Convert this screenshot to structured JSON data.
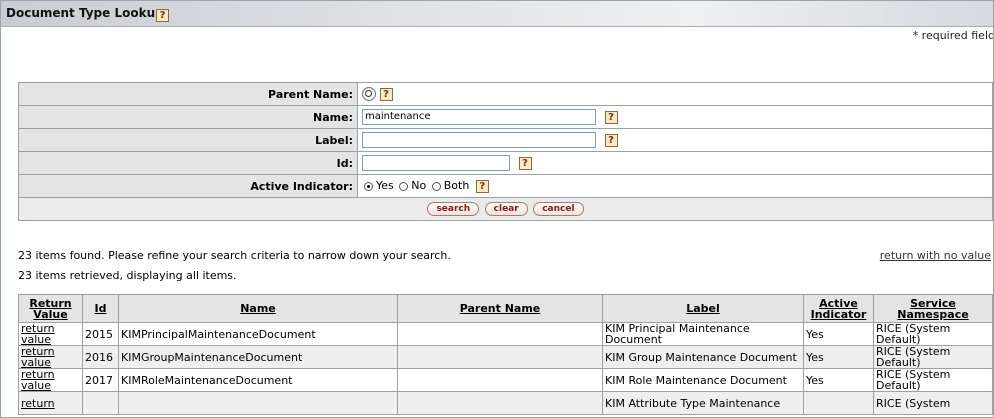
{
  "window": {
    "title": "Document Type Lookup"
  },
  "required_note": "* required field",
  "criteria": {
    "parent_name_label": "Parent Name:",
    "name_label": "Name:",
    "name_value": "maintenance",
    "label_label": "Label:",
    "label_value": "",
    "id_label": "Id:",
    "id_value": "",
    "active_label": "Active Indicator:",
    "active_options": [
      "Yes",
      "No",
      "Both"
    ],
    "active_selected": "Yes",
    "help_glyph": "?"
  },
  "buttons": {
    "search": "search",
    "clear": "clear",
    "cancel": "cancel"
  },
  "messages": {
    "found": "23 items found.  Please refine your search criteria to narrow down your search.",
    "retrieved": "23 items retrieved, displaying all items.",
    "return_no_value": "return with no value"
  },
  "results": {
    "headers": [
      "Return Value",
      "Id",
      "Name",
      "Parent Name",
      "Label",
      "Active Indicator",
      "Service Namespace"
    ],
    "rows": [
      {
        "return": "return value",
        "id": "2015",
        "name": "KIMPrincipalMaintenanceDocument",
        "parent": "",
        "label": "KIM Principal Maintenance Document",
        "active": "Yes",
        "namespace": "RICE (System Default)"
      },
      {
        "return": "return value",
        "id": "2016",
        "name": "KIMGroupMaintenanceDocument",
        "parent": "",
        "label": "KIM Group Maintenance Document",
        "active": "Yes",
        "namespace": "RICE (System Default)"
      },
      {
        "return": "return value",
        "id": "2017",
        "name": "KIMRoleMaintenanceDocument",
        "parent": "",
        "label": "KIM Role Maintenance Document",
        "active": "Yes",
        "namespace": "RICE (System Default)"
      },
      {
        "return": "return",
        "id": "",
        "name": "",
        "parent": "",
        "label": "KIM Attribute Type Maintenance",
        "active": "",
        "namespace": "RICE (System"
      }
    ]
  }
}
